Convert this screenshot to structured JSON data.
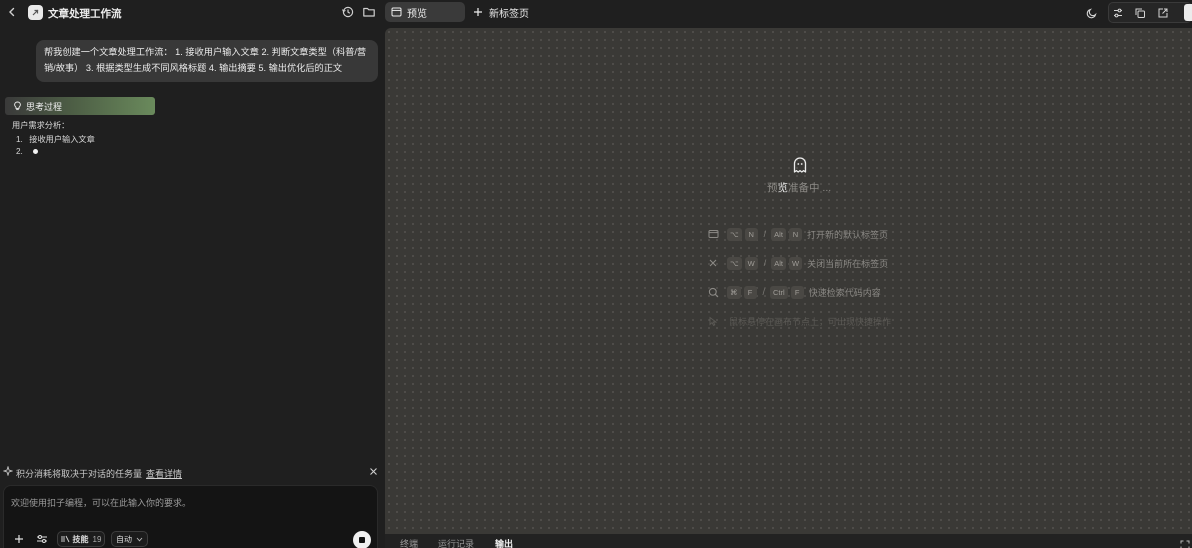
{
  "header": {
    "title": "文章处理工作流"
  },
  "chat": {
    "user_message": "帮我创建一个文章处理工作流： 1. 接收用户输入文章 2. 判断文章类型（科普/营销/故事） 3. 根据类型生成不同风格标题 4. 输出摘要 5. 输出优化后的正文",
    "thinking_label": "思考过程",
    "analysis_title": "用户需求分析：",
    "analysis_items": [
      {
        "num": "1.",
        "text": "接收用户输入文章"
      },
      {
        "num": "2.",
        "text": ""
      }
    ]
  },
  "notice": {
    "text": "积分消耗将取决于对话的任务量",
    "link": "查看详情"
  },
  "composer": {
    "placeholder": "欢迎使用扣子编程，可以在此输入你的要求。",
    "skills_label": "技能",
    "skills_count": "19",
    "mode_label": "自动"
  },
  "top_tabs": {
    "preview": "预览",
    "new_tab": "新标签页"
  },
  "canvas": {
    "loading_prefix": "预",
    "loading_highlight": "览",
    "loading_suffix": "准备中 ...",
    "shortcuts": [
      {
        "icon": "window-icon",
        "key1": "⌥",
        "key2": "N",
        "key3": "Alt",
        "key4": "N",
        "desc": "打开新的默认标签页"
      },
      {
        "icon": "close-icon",
        "key1": "⌥",
        "key2": "W",
        "key3": "Alt",
        "key4": "W",
        "desc": "关闭当前所在标签页"
      },
      {
        "icon": "search-icon",
        "key1": "⌘",
        "key2": "F",
        "key3": "Ctrl",
        "key4": "F",
        "desc": "快速检索代码内容"
      }
    ],
    "hint": "鼠标悬停在画布节点上，可出现快捷操作"
  },
  "bottom_tabs": {
    "terminal": "终端",
    "run_log": "运行记录",
    "output": "输出"
  },
  "colors": {
    "background": "#1f1f1f",
    "canvas": "#3a3936",
    "thinking_accent": "#6a8a5c"
  }
}
